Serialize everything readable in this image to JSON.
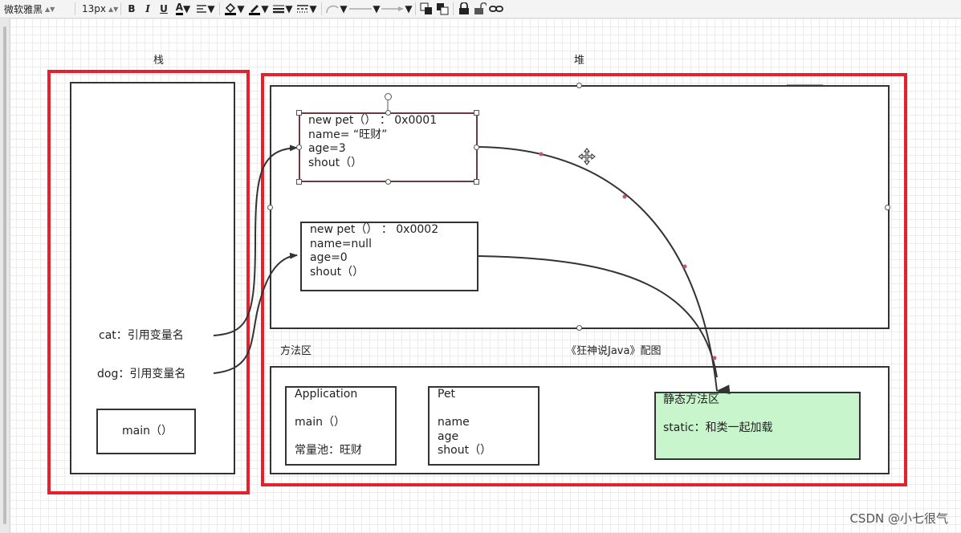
{
  "toolbar": {
    "font_family": "微软雅黑",
    "font_size": "13px",
    "bold": "B",
    "italic": "I",
    "underline": "U",
    "font_color": "A"
  },
  "labels": {
    "stack": "栈",
    "heap": "堆",
    "method_area": "方法区",
    "caption": "《狂神说Java》配图"
  },
  "stack_area": {
    "cat": "cat：引用变量名",
    "dog": "dog：引用变量名",
    "main": "main（）"
  },
  "heap_area": {
    "obj1": [
      "new pet（）  ：  0x0001",
      "name= “旺财”",
      "age=3",
      "shout（）"
    ],
    "obj2": [
      "new pet（）  ：  0x0002",
      "name=null",
      "age=0",
      "shout（）"
    ]
  },
  "method_area": {
    "application": {
      "title": "Application",
      "method": "main（）",
      "pool": "常量池：旺财"
    },
    "pet": {
      "title": "Pet",
      "fields": [
        "name",
        "age",
        "shout（）"
      ]
    },
    "static": {
      "title": "静态方法区",
      "desc": "static：和类一起加载"
    }
  },
  "watermark": "CSDN @小七很气",
  "colors": {
    "red_border": "#e3222b",
    "static_fill": "#c8f5cc",
    "line": "#333333",
    "grid": "#ececec"
  }
}
